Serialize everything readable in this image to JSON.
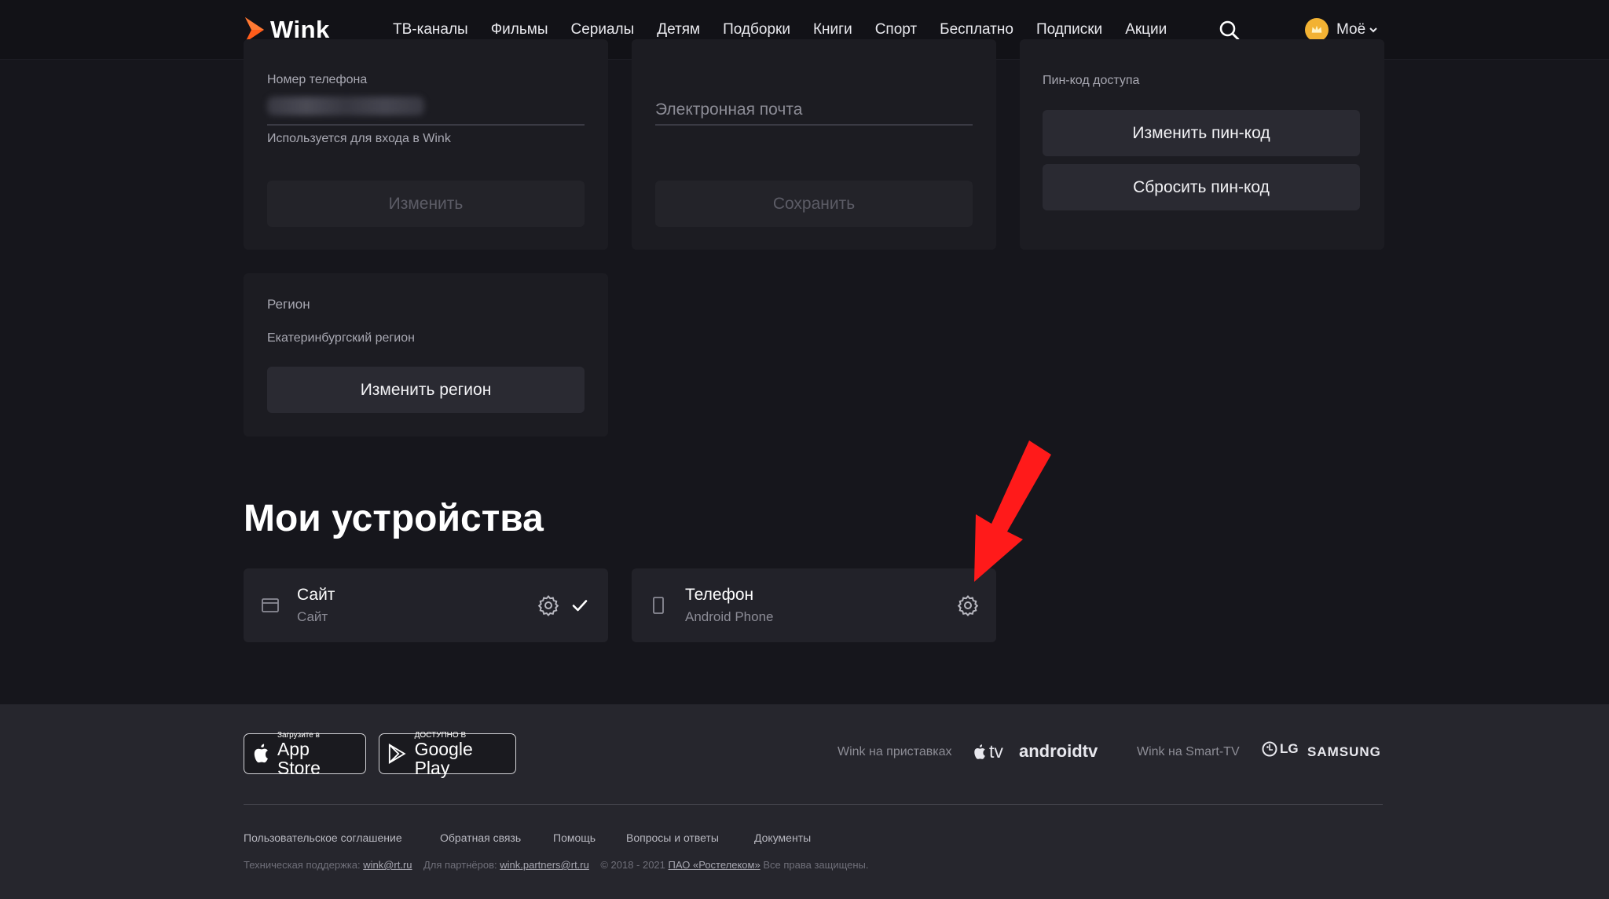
{
  "header": {
    "logo_text": "Wink",
    "nav": [
      "ТВ-каналы",
      "Фильмы",
      "Сериалы",
      "Детям",
      "Подборки",
      "Книги",
      "Спорт",
      "Бесплатно",
      "Подписки",
      "Акции"
    ],
    "profile_label": "Моё"
  },
  "phone_card": {
    "label": "Номер телефона",
    "hint": "Используется для входа в Wink",
    "button": "Изменить"
  },
  "email_card": {
    "placeholder": "Электронная почта",
    "button": "Сохранить"
  },
  "pin_card": {
    "label": "Пин-код доступа",
    "change_button": "Изменить пин-код",
    "reset_button": "Сбросить пин-код"
  },
  "region_card": {
    "label": "Регион",
    "value": "Екатеринбургский регион",
    "button": "Изменить регион"
  },
  "devices": {
    "title": "Мои устройства",
    "items": [
      {
        "name": "Сайт",
        "sub": "Сайт",
        "icon": "browser-icon",
        "current": true
      },
      {
        "name": "Телефон",
        "sub": "Android Phone",
        "icon": "phone-icon",
        "current": false
      }
    ]
  },
  "footer": {
    "appstore_small": "Загрузите в",
    "appstore_big": "App Store",
    "gplay_small": "ДОСТУПНО В",
    "gplay_big": "Google Play",
    "stb_label": "Wink на приставках",
    "smarttv_label": "Wink на Smart-TV",
    "brands": {
      "appletv": "tv",
      "androidtv": "androidtv",
      "lg": "LG",
      "samsung": "SAMSUNG"
    },
    "links": [
      "Пользовательское соглашение",
      "Обратная связь",
      "Помощь",
      "Вопросы и ответы",
      "Документы"
    ],
    "support_label": "Техническая поддержка:",
    "support_email": "wink@rt.ru",
    "partners_label": "Для партнёров:",
    "partners_email": "wink.partners@rt.ru",
    "copyright": "© 2018 - 2021",
    "company": "ПАО «Ростелеком»",
    "rights": "Все права защищены."
  },
  "colors": {
    "accent": "#ff5c1a",
    "annotation_arrow": "#ff1a1a"
  }
}
